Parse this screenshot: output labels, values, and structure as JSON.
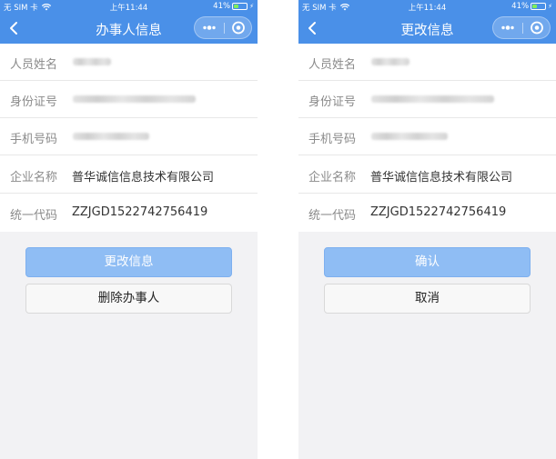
{
  "status_bar": {
    "carrier": "无 SIM 卡",
    "time": "上午11:44",
    "battery": "41%",
    "battery_level": 0.41
  },
  "left": {
    "title": "办事人信息",
    "rows": [
      {
        "label": "人员姓名",
        "value": ""
      },
      {
        "label": "身份证号",
        "value": ""
      },
      {
        "label": "手机号码",
        "value": ""
      },
      {
        "label": "企业名称",
        "value": "普华诚信信息技术有限公司"
      },
      {
        "label": "统一代码",
        "value": "ZZJGD1522742756419"
      }
    ],
    "primary_button": "更改信息",
    "secondary_button": "删除办事人"
  },
  "right": {
    "title": "更改信息",
    "rows": [
      {
        "label": "人员姓名",
        "value": ""
      },
      {
        "label": "身份证号",
        "value": ""
      },
      {
        "label": "手机号码",
        "value": ""
      },
      {
        "label": "企业名称",
        "value": "普华诚信信息技术有限公司"
      },
      {
        "label": "统一代码",
        "value": "ZZJGD1522742756419"
      }
    ],
    "primary_button": "确认",
    "secondary_button": "取消"
  },
  "colors": {
    "header": "#4a90e8",
    "primary_button": "#8fbdf4",
    "background": "#f2f2f4"
  },
  "icons": {
    "back": "chevron-left-icon",
    "more": "more-dots-icon",
    "close": "target-circle-icon"
  }
}
